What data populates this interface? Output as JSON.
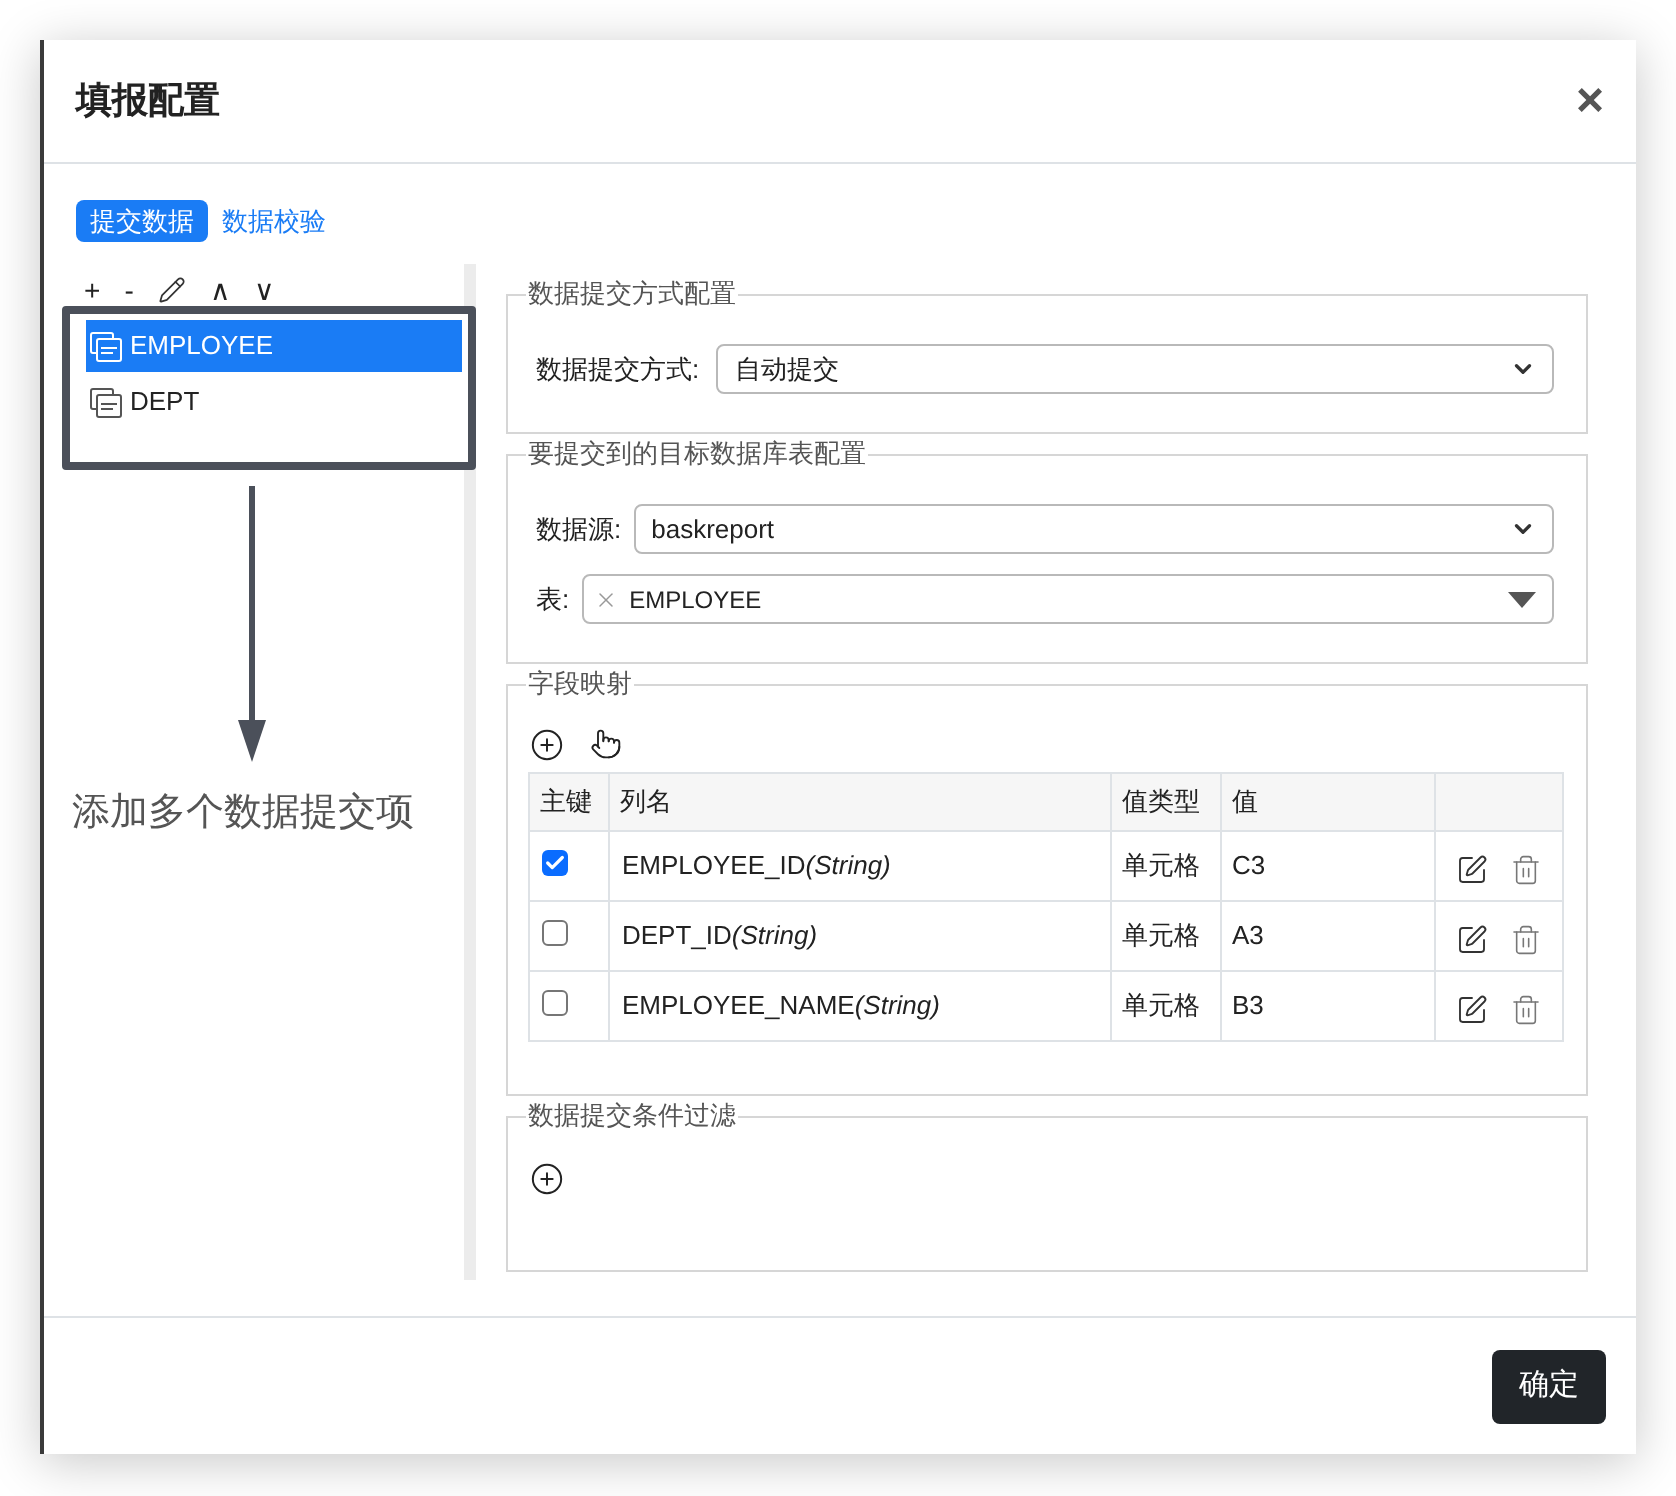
{
  "dialog": {
    "title": "填报配置",
    "close": "×"
  },
  "tabs": [
    {
      "label": "提交数据",
      "selected": true
    },
    {
      "label": "数据校验",
      "selected": false
    }
  ],
  "tree_toolbar": {
    "add": "+",
    "remove": "-",
    "move_up": "∧",
    "move_down": "∨"
  },
  "submissions": [
    {
      "name": "EMPLOYEE",
      "selected": true
    },
    {
      "name": "DEPT",
      "selected": false
    }
  ],
  "annotation": "添加多个数据提交项",
  "submit_mode": {
    "legend": "数据提交方式配置",
    "label": "数据提交方式:",
    "value": "自动提交"
  },
  "target": {
    "legend": "要提交到的目标数据库表配置",
    "datasource_label": "数据源:",
    "datasource": "baskreport",
    "table_label": "表:",
    "tables": [
      "EMPLOYEE"
    ]
  },
  "field_mapping": {
    "legend": "字段映射",
    "columns": [
      "主键",
      "列名",
      "值类型",
      "值"
    ],
    "rows": [
      {
        "primary_key": true,
        "column": "EMPLOYEE_ID",
        "data_type": "(String)",
        "value_type": "单元格",
        "value": "C3"
      },
      {
        "primary_key": false,
        "column": "DEPT_ID",
        "data_type": "(String)",
        "value_type": "单元格",
        "value": "A3"
      },
      {
        "primary_key": false,
        "column": "EMPLOYEE_NAME",
        "data_type": "(String)",
        "value_type": "单元格",
        "value": "B3"
      }
    ]
  },
  "filter": {
    "legend": "数据提交条件过滤"
  },
  "footer": {
    "confirm": "确定"
  }
}
